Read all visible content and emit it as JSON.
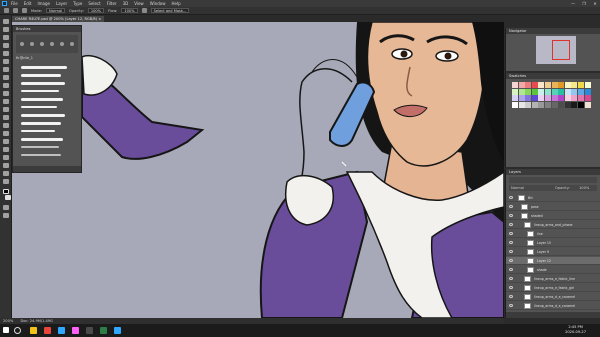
{
  "app": {
    "menu": [
      "File",
      "Edit",
      "Image",
      "Layer",
      "Type",
      "Select",
      "Filter",
      "3D",
      "View",
      "Window",
      "Help"
    ],
    "window_controls": [
      "—",
      "❐",
      "✕"
    ]
  },
  "options_bar": {
    "mode_label": "Mode:",
    "mode_value": "Normal",
    "opacity_label": "Opacity:",
    "opacity_value": "100%",
    "flow_label": "Flow:",
    "flow_value": "100%",
    "select_mask_label": "Select and Mask..."
  },
  "document": {
    "tab_title": "CHARE R4U?E.psd @ 200% (Layer 12, RGB/8) ×"
  },
  "brushes_panel": {
    "title": "Brushes",
    "group_name": "Kr@nte_1"
  },
  "navigator": {
    "title": "Navigator"
  },
  "swatches": {
    "title": "Swatches",
    "colors": [
      "#f7d4d4",
      "#f2a8a8",
      "#ee7a7a",
      "#e84b4b",
      "#f7e6c8",
      "#f2cc91",
      "#ecb25a",
      "#e09826",
      "#fbf5c2",
      "#f5e889",
      "#efd94a",
      "#f7ffd0",
      "#d6f2c2",
      "#b1e690",
      "#86d65a",
      "#5ec23a",
      "#c8f2e8",
      "#8fe4d1",
      "#56d2b7",
      "#26bfa0",
      "#c9e4f7",
      "#93c7ee",
      "#5ea8e3",
      "#2c8ad7",
      "#d6d0f5",
      "#aca2ea",
      "#8274de",
      "#5a4ad2",
      "#ecd0f2",
      "#d9a3e6",
      "#c674d9",
      "#b044cb",
      "#f7d0e4",
      "#eea3c9",
      "#e574ad",
      "#dc4691",
      "#ffffff",
      "#e6e6e6",
      "#cccccc",
      "#b3b3b3",
      "#999999",
      "#808080",
      "#666666",
      "#4d4d4d",
      "#333333",
      "#1a1a1a",
      "#000000",
      "#f0e0d0"
    ]
  },
  "layers_panel": {
    "title": "Layers",
    "blend_mode": "Normal",
    "opacity_label": "Opacity:",
    "opacity_value": "100%",
    "layers": [
      {
        "name": "Brt"
      },
      {
        "name": "pose"
      },
      {
        "name": "shaded"
      },
      {
        "name": "lineup_arms_and_phone"
      },
      {
        "name": "line"
      },
      {
        "name": "Layer 15"
      },
      {
        "name": "Layer 9"
      },
      {
        "name": "Layer 12"
      },
      {
        "name": "shade"
      },
      {
        "name": "lineup_arms_e_fabric_line"
      },
      {
        "name": "lineup_arms_e_fabric_girl"
      },
      {
        "name": "lineup_arms_d_e_caramel"
      },
      {
        "name": "lineup_arms_d_e_caramel"
      }
    ]
  },
  "status_bar": {
    "zoom": "200%",
    "doc_size": "Doc: 24.9M/1.49G"
  },
  "taskbar": {
    "time": "2:45 PM",
    "date": "2020-09-27",
    "colors": [
      "#f3c21a",
      "#e8453c",
      "#31a8ff",
      "#ff61f6",
      "#4a4a4a",
      "#2d7d46",
      "#31a8ff"
    ]
  }
}
